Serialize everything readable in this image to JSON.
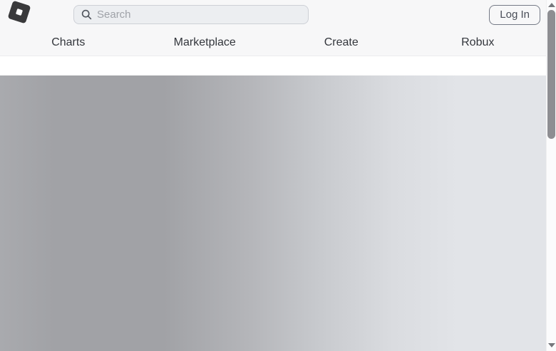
{
  "header": {
    "search": {
      "placeholder": "Search",
      "value": ""
    },
    "login_button": "Log In"
  },
  "nav": {
    "items": [
      {
        "label": "Charts"
      },
      {
        "label": "Marketplace"
      },
      {
        "label": "Create"
      },
      {
        "label": "Robux"
      }
    ]
  },
  "icons": {
    "logo": "roblox-tilted-square-icon",
    "search": "magnifier-icon",
    "scroll_up": "triangle-up-icon",
    "scroll_down": "triangle-down-icon"
  },
  "content": {
    "state": "loading-shimmer-placeholder"
  },
  "colors": {
    "header_bg": "#f7f7f8",
    "header_border": "#ececee",
    "nav_text": "#33363c",
    "logo": "#39393b",
    "search_bg": "#eceef1",
    "search_border": "#cdd0d6",
    "search_placeholder": "#9fa2a8",
    "login_border": "#757a86",
    "login_text": "#4a4e58",
    "shimmer_a": "#a9aaae",
    "shimmer_b": "#a1a2a6",
    "shimmer_c": "#c7c9cd",
    "shimmer_d": "#e2e4e8",
    "scroll_track": "#fbfbfc",
    "scroll_thumb": "#8e8e92",
    "scroll_arrow": "#75777c"
  }
}
